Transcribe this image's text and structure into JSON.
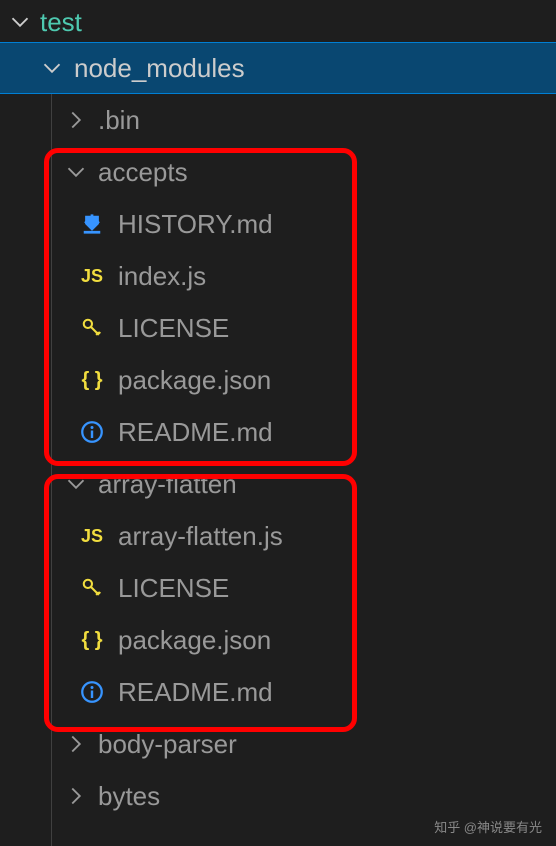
{
  "tree": {
    "root": {
      "name": "test",
      "expanded": true
    },
    "node_modules": {
      "name": "node_modules",
      "expanded": true
    },
    "folders": {
      "bin": {
        "name": ".bin",
        "expanded": false
      },
      "accepts": {
        "name": "accepts",
        "expanded": true,
        "files": [
          {
            "name": "HISTORY.md",
            "icon": "arrow-down"
          },
          {
            "name": "index.js",
            "icon": "js"
          },
          {
            "name": "LICENSE",
            "icon": "key"
          },
          {
            "name": "package.json",
            "icon": "json"
          },
          {
            "name": "README.md",
            "icon": "info"
          }
        ]
      },
      "array_flatten": {
        "name": "array-flatten",
        "expanded": true,
        "files": [
          {
            "name": "array-flatten.js",
            "icon": "js"
          },
          {
            "name": "LICENSE",
            "icon": "key"
          },
          {
            "name": "package.json",
            "icon": "json"
          },
          {
            "name": "README.md",
            "icon": "info"
          }
        ]
      },
      "body_parser": {
        "name": "body-parser",
        "expanded": false
      },
      "bytes": {
        "name": "bytes",
        "expanded": false
      }
    }
  },
  "watermark": "知乎 @神说要有光"
}
